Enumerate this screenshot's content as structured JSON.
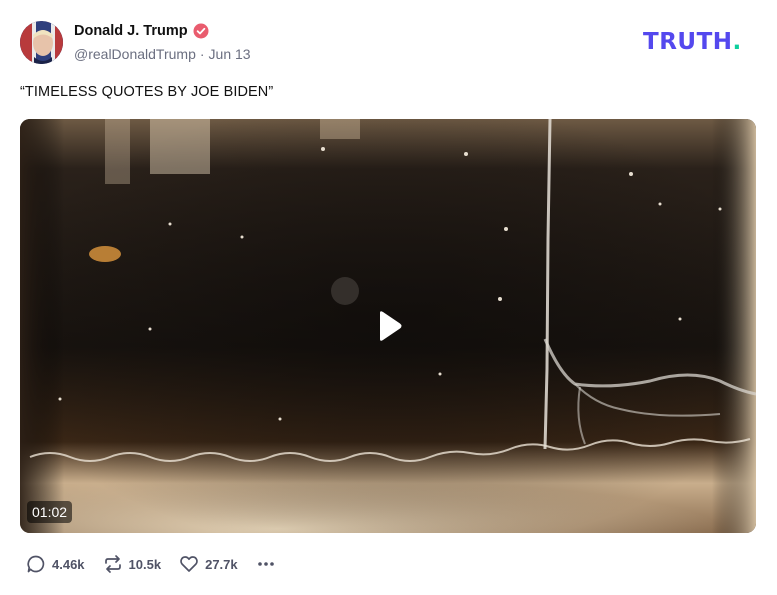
{
  "author": {
    "display_name": "Donald J. Trump",
    "handle": "@realDonaldTrump",
    "separator": "·",
    "date": "Jun 13"
  },
  "brand": {
    "logo_text": "TRUTH",
    "logo_dot": ".",
    "color": "#5448ee",
    "dot_color": "#0ccf9c"
  },
  "post": {
    "text": "“TIMELESS QUOTES BY JOE BIDEN”"
  },
  "video": {
    "duration": "01:02",
    "play_icon": "play-icon"
  },
  "actions": {
    "replies": "4.46k",
    "reposts": "10.5k",
    "likes": "27.7k",
    "icons": [
      "reply-icon",
      "repost-icon",
      "heart-icon",
      "more-icon"
    ]
  },
  "colors": {
    "verified_badge": "#e95c6e",
    "action_gray": "#505366"
  }
}
